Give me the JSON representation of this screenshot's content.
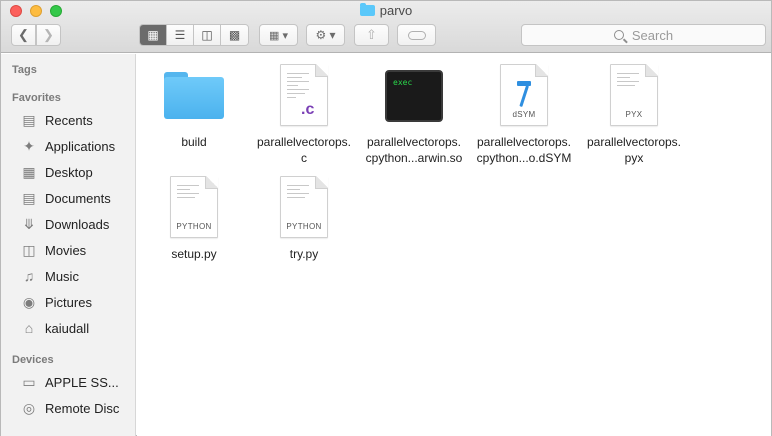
{
  "window": {
    "title": "parvo"
  },
  "toolbar": {
    "back_icon": "chevron-left-icon",
    "forward_icon": "chevron-right-icon",
    "view_modes": [
      "icon",
      "list",
      "column",
      "cover-flow"
    ],
    "active_view": "icon",
    "search_placeholder": "Search"
  },
  "sidebar": {
    "tags_heading": "Tags",
    "favorites_heading": "Favorites",
    "favorites": [
      {
        "label": "Recents",
        "icon": "clock-icon"
      },
      {
        "label": "Applications",
        "icon": "applications-icon"
      },
      {
        "label": "Desktop",
        "icon": "desktop-icon"
      },
      {
        "label": "Documents",
        "icon": "documents-icon"
      },
      {
        "label": "Downloads",
        "icon": "downloads-icon"
      },
      {
        "label": "Movies",
        "icon": "film-icon"
      },
      {
        "label": "Music",
        "icon": "music-note-icon"
      },
      {
        "label": "Pictures",
        "icon": "camera-icon"
      },
      {
        "label": "kaiudall",
        "icon": "home-icon"
      }
    ],
    "devices_heading": "Devices",
    "devices": [
      {
        "label": "APPLE SS...",
        "icon": "disk-icon"
      },
      {
        "label": "Remote Disc",
        "icon": "disc-icon"
      }
    ]
  },
  "files": [
    {
      "name_line1": "build",
      "name_line2": "",
      "kind": "folder"
    },
    {
      "name_line1": "parallelvectorops.",
      "name_line2": "c",
      "kind": "c-source",
      "badge": ".c"
    },
    {
      "name_line1": "parallelvectorops.",
      "name_line2": "cpython...arwin.so",
      "kind": "exec",
      "badge": "exec"
    },
    {
      "name_line1": "parallelvectorops.",
      "name_line2": "cpython...o.dSYM",
      "kind": "dsym",
      "badge": "dSYM"
    },
    {
      "name_line1": "parallelvectorops.",
      "name_line2": "pyx",
      "kind": "pyx",
      "badge": "PYX"
    },
    {
      "name_line1": "setup.py",
      "name_line2": "",
      "kind": "python",
      "badge": "PYTHON"
    },
    {
      "name_line1": "try.py",
      "name_line2": "",
      "kind": "python",
      "badge": "PYTHON"
    }
  ],
  "colors": {
    "folder_blue": "#5ac8fa",
    "close_red": "#fc605c",
    "minimize_yellow": "#fdbc40",
    "maximize_green": "#34c84a"
  }
}
